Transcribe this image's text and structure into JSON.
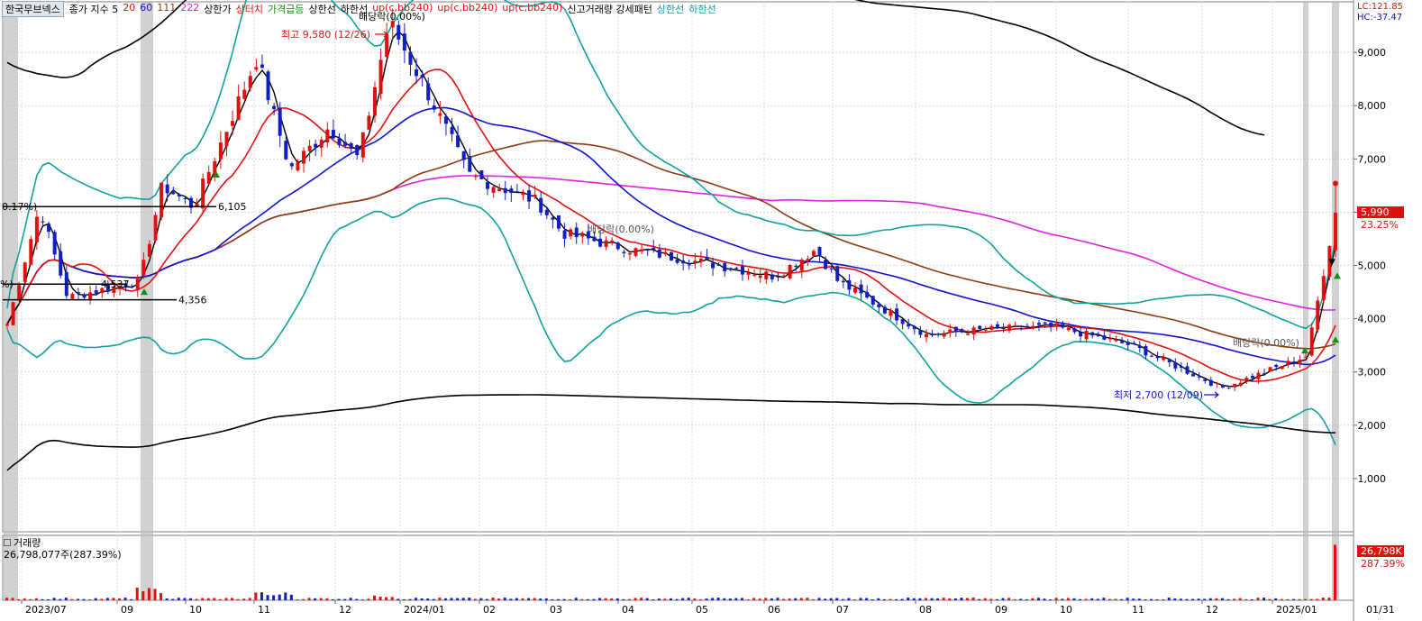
{
  "header": {
    "stock_name": "한국무브넥스",
    "indicators": [
      {
        "label": "종가 지수 5",
        "color": "#000000"
      },
      {
        "label": "20",
        "color": "#e01010"
      },
      {
        "label": "60",
        "color": "#1010d0"
      },
      {
        "label": "111",
        "color": "#8b3a0f"
      },
      {
        "label": "222",
        "color": "#e020e0"
      },
      {
        "label": "상한가",
        "color": "#000000"
      },
      {
        "label": "상터치",
        "color": "#e01010"
      },
      {
        "label": "가격급등",
        "color": "#109010"
      },
      {
        "label": "상한선",
        "color": "#000000"
      },
      {
        "label": "하한선",
        "color": "#000000"
      },
      {
        "label": "up(c,bb240)",
        "color": "#e01010"
      },
      {
        "label": "up(c,bb240)",
        "color": "#e01010"
      },
      {
        "label": "up(c,bb240)",
        "color": "#e01010"
      },
      {
        "label": "신고거래량 강세패턴",
        "color": "#000000"
      },
      {
        "label": "상한선",
        "color": "#10a0a0"
      },
      {
        "label": "하한선",
        "color": "#10a0a0"
      }
    ]
  },
  "right_info": {
    "lc": "LC:121.85",
    "hc": "HC:-37.47",
    "last_price": "5,990",
    "last_change": "23.25%"
  },
  "volume_panel": {
    "title": "거래량",
    "value": "26,798,077주(287.39%)",
    "last_value": "26,798K",
    "last_change": "287.39%"
  },
  "annotations": {
    "high_label": "최고 9,580 (12/26)",
    "low_label": "최저 2,700 (12/09)",
    "dividend_1": "배당락(0.00%)",
    "dividend_2": "배당락(0.00%)",
    "dividend_3": "배당락(0.00%)",
    "level_6105": "6,105",
    "level_4356": "4,356",
    "level_4537": "4,537",
    "left_pct": "0.17%)",
    "left_paren": "%)"
  },
  "chart_data": {
    "type": "candlestick",
    "period": "2023/07 - 2025/01",
    "x_axis_labels": [
      "2023/07",
      "09",
      "10",
      "11",
      "12",
      "2024/01",
      "02",
      "03",
      "04",
      "05",
      "06",
      "07",
      "08",
      "09",
      "10",
      "11",
      "12",
      "2025/01",
      "01/31"
    ],
    "y_ticks": [
      1000,
      2000,
      3000,
      4000,
      5000,
      6000,
      7000,
      8000,
      9000
    ],
    "y_tick_labels": [
      "1,000",
      "2,000",
      "3,000",
      "4,000",
      "5,000",
      "6,000",
      "7,000",
      "8,000",
      "9,000"
    ],
    "ylim": [
      0,
      9950
    ],
    "close_keypoints": [
      [
        "2023/07",
        3900
      ],
      [
        "2023/07 mid",
        6100
      ],
      [
        "2023/08",
        4400
      ],
      [
        "2023/09",
        4700
      ],
      [
        "2023/09 end",
        6500
      ],
      [
        "2023/10",
        6100
      ],
      [
        "2023/11",
        8900
      ],
      [
        "2023/11 mid",
        6800
      ],
      [
        "2023/12",
        7600
      ],
      [
        "2023/12 mid",
        7000
      ],
      [
        "2023/12/26",
        9580
      ],
      [
        "2024/01",
        8400
      ],
      [
        "2024/02",
        6700
      ],
      [
        "2024/03",
        6200
      ],
      [
        "2024/03 mid",
        5600
      ],
      [
        "2024/04",
        5300
      ],
      [
        "2024/05",
        5100
      ],
      [
        "2024/06",
        4800
      ],
      [
        "2024/06 end",
        5300
      ],
      [
        "2024/07",
        4700
      ],
      [
        "2024/08",
        3700
      ],
      [
        "2024/09",
        3800
      ],
      [
        "2024/10",
        3850
      ],
      [
        "2024/11",
        3500
      ],
      [
        "2024/12/09",
        2700
      ],
      [
        "2025/01",
        3300
      ],
      [
        "2025/01 end",
        5990
      ]
    ],
    "ma_lines": [
      {
        "name": "5",
        "color": "#000000"
      },
      {
        "name": "20",
        "color": "#e01010"
      },
      {
        "name": "60",
        "color": "#1010d0"
      },
      {
        "name": "111",
        "color": "#8b3a0f"
      },
      {
        "name": "222",
        "color": "#e020e0"
      }
    ],
    "bands": [
      {
        "name": "상한선",
        "color": "#000000"
      },
      {
        "name": "하한선",
        "color": "#000000"
      },
      {
        "name": "상한선",
        "color": "#10a0a0"
      },
      {
        "name": "하한선",
        "color": "#10a0a0"
      }
    ],
    "last_close": 5990,
    "high": 9580,
    "low": 2700,
    "volume_last": 26798077
  }
}
